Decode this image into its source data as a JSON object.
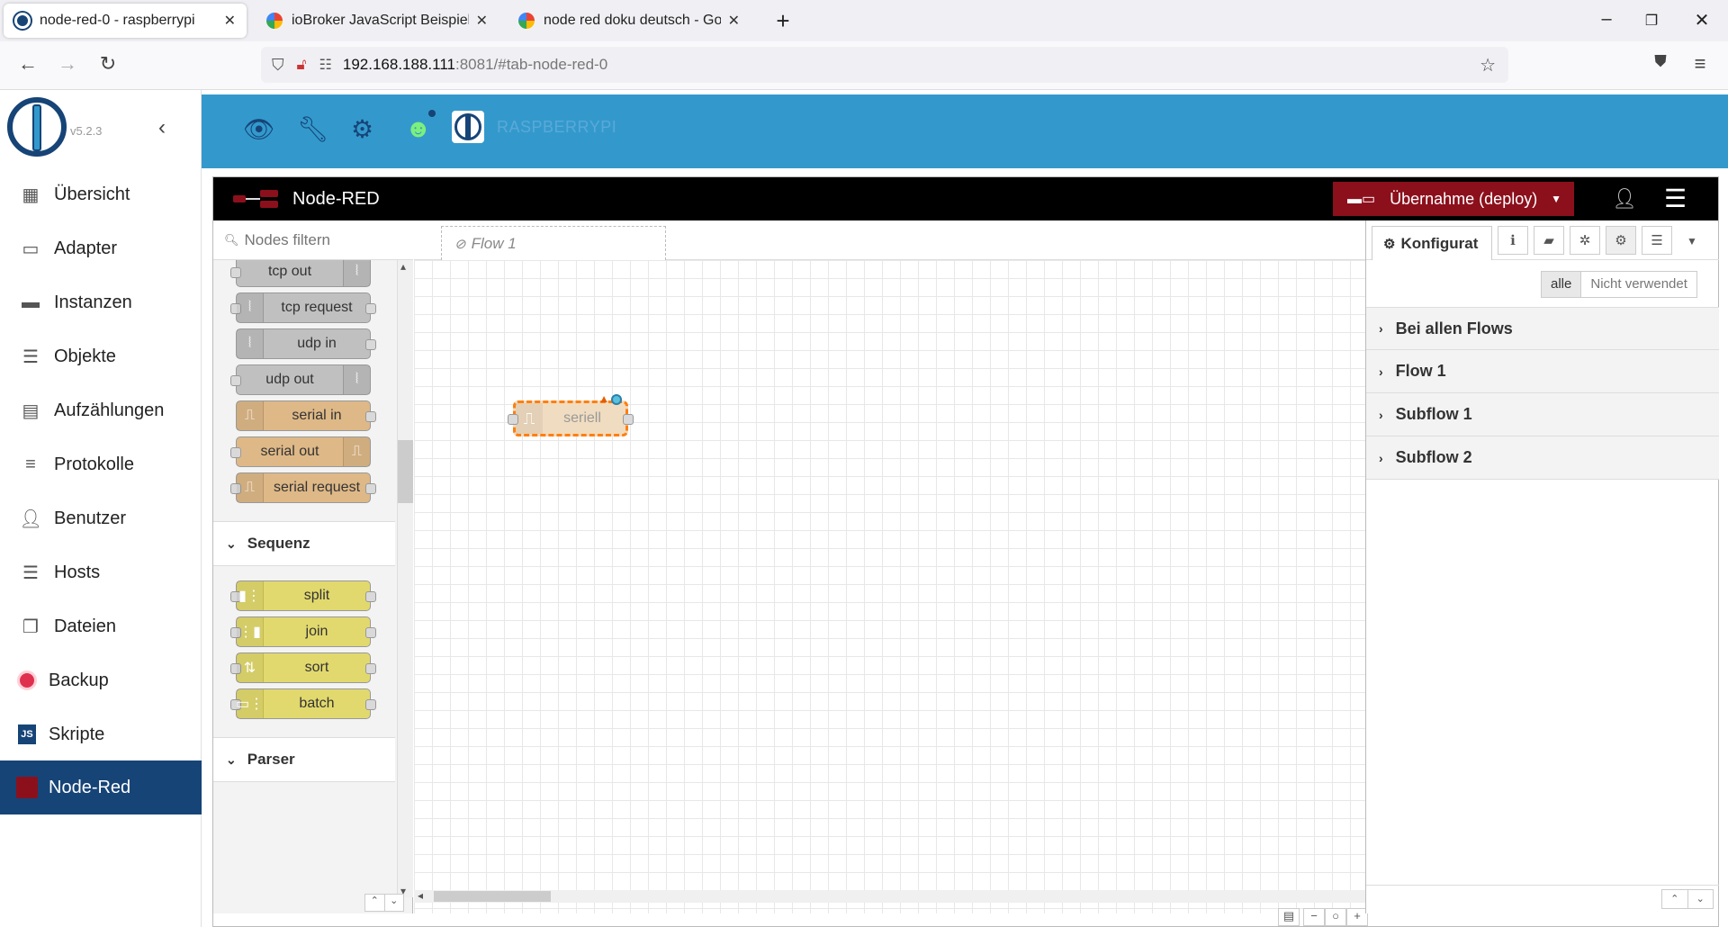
{
  "browser": {
    "tabs": [
      {
        "title": "node-red-0 - raspberrypi",
        "active": true
      },
      {
        "title": "ioBroker JavaScript Beispiele - G",
        "active": false
      },
      {
        "title": "node red doku deutsch - Google",
        "active": false
      }
    ],
    "url_host": "192.168.188.111",
    "url_path": ":8081/#tab-node-red-0"
  },
  "iobroker": {
    "version": "v5.2.3",
    "host_label": "RASPBERRYPI",
    "menu": [
      {
        "label": "Übersicht",
        "icon": "grid-icon"
      },
      {
        "label": "Adapter",
        "icon": "store-icon"
      },
      {
        "label": "Instanzen",
        "icon": "instances-icon"
      },
      {
        "label": "Objekte",
        "icon": "list-icon"
      },
      {
        "label": "Aufzählungen",
        "icon": "enum-icon"
      },
      {
        "label": "Protokolle",
        "icon": "log-icon"
      },
      {
        "label": "Benutzer",
        "icon": "user-icon"
      },
      {
        "label": "Hosts",
        "icon": "hosts-icon"
      },
      {
        "label": "Dateien",
        "icon": "files-icon"
      },
      {
        "label": "Backup",
        "icon": "backup-icon"
      },
      {
        "label": "Skripte",
        "icon": "js-icon"
      },
      {
        "label": "Node-Red",
        "icon": "node-red-icon"
      }
    ],
    "accent": "#3399cc",
    "active_bg": "#164477"
  },
  "nodered": {
    "title": "Node-RED",
    "deploy_label": "Übernahme (deploy)",
    "deploy_color": "#8c101c",
    "filter_placeholder": "Nodes filtern",
    "flow_tab": "Flow 1",
    "palette_nodes": [
      {
        "label": "tcp out",
        "color": "#c0c0c0"
      },
      {
        "label": "tcp request",
        "color": "#c0c0c0"
      },
      {
        "label": "udp in",
        "color": "#c0c0c0"
      },
      {
        "label": "udp out",
        "color": "#c0c0c0"
      },
      {
        "label": "serial in",
        "color": "#deb887"
      },
      {
        "label": "serial out",
        "color": "#deb887"
      },
      {
        "label": "serial request",
        "color": "#deb887"
      }
    ],
    "category_sequenz": "Sequenz",
    "sequenz_nodes": [
      {
        "label": "split",
        "color": "#e2d96e"
      },
      {
        "label": "join",
        "color": "#e2d96e"
      },
      {
        "label": "sort",
        "color": "#e2d96e"
      },
      {
        "label": "batch",
        "color": "#e2d96e"
      }
    ],
    "category_parser": "Parser",
    "canvas_node": "seriell",
    "sidebar": {
      "tab_label": "Konfigurat",
      "filter_all": "alle",
      "filter_unused": "Nicht verwendet",
      "sections": [
        "Bei allen Flows",
        "Flow 1",
        "Subflow 1",
        "Subflow 2"
      ]
    }
  }
}
